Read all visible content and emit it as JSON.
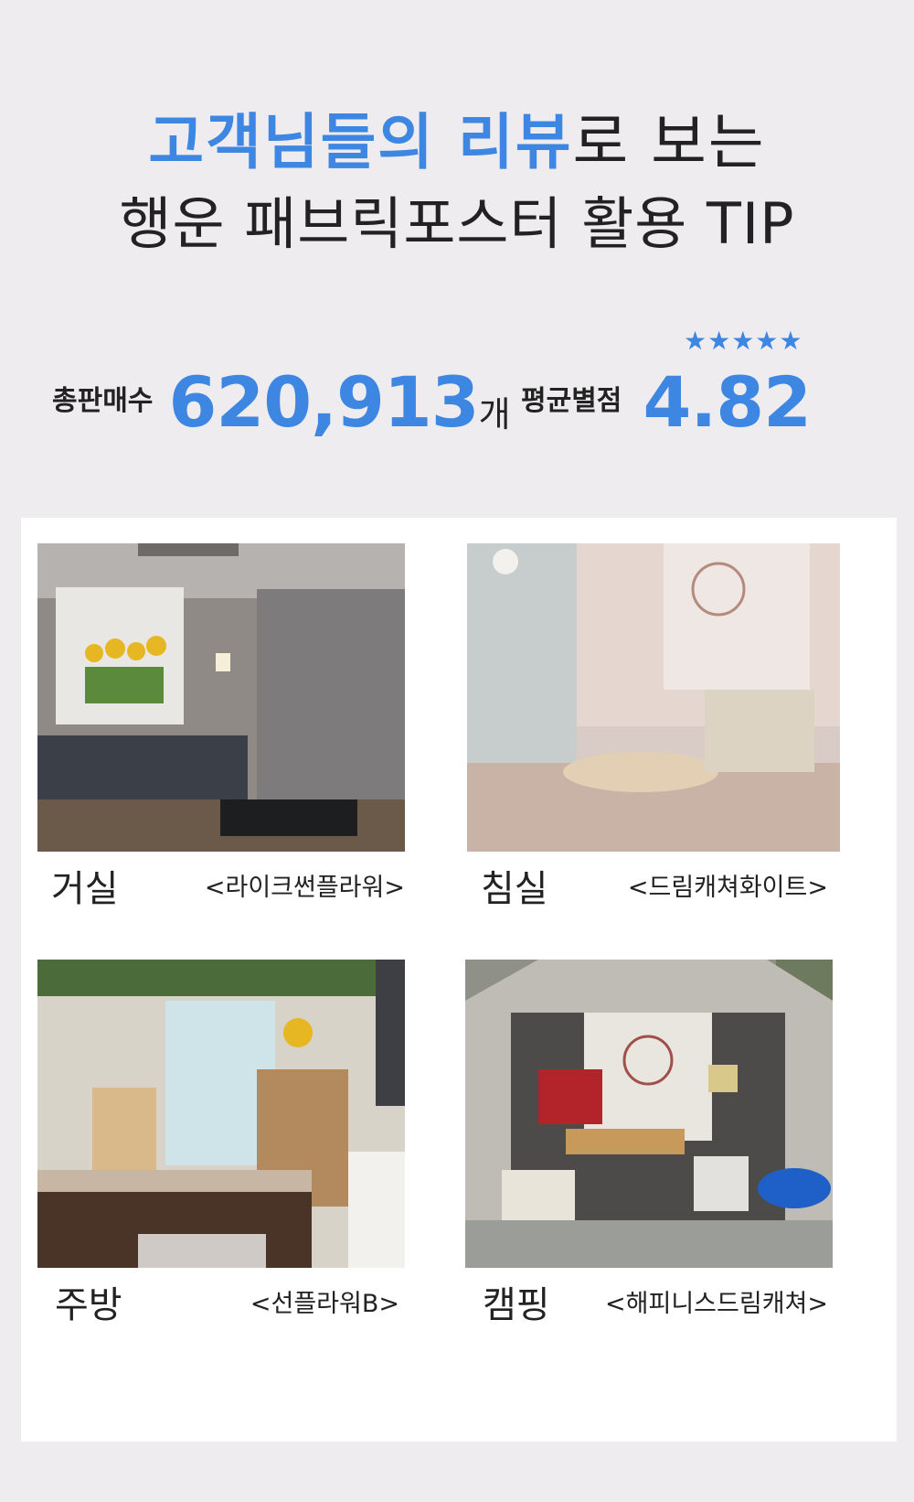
{
  "headline": {
    "line1_accent": "고객님들의 리뷰",
    "line1_plain": "로 보는",
    "line2": "행운 패브릭포스터 활용 TIP"
  },
  "stats": {
    "sales": {
      "label": "총판매수",
      "value": "620,913",
      "unit": "개"
    },
    "rating": {
      "label": "평균별점",
      "value": "4.82",
      "stars": "★★★★★",
      "stars_count": 5
    }
  },
  "colors": {
    "accent": "#3d86e1",
    "background": "#eeecee",
    "card": "#ffffff",
    "text": "#222222"
  },
  "gallery": [
    {
      "room": "거실",
      "product": "<라이크썬플라워>"
    },
    {
      "room": "침실",
      "product": "<드림캐쳐화이트>"
    },
    {
      "room": "주방",
      "product": "<선플라워B>"
    },
    {
      "room": "캠핑",
      "product": "<해피니스드림캐쳐>"
    }
  ]
}
